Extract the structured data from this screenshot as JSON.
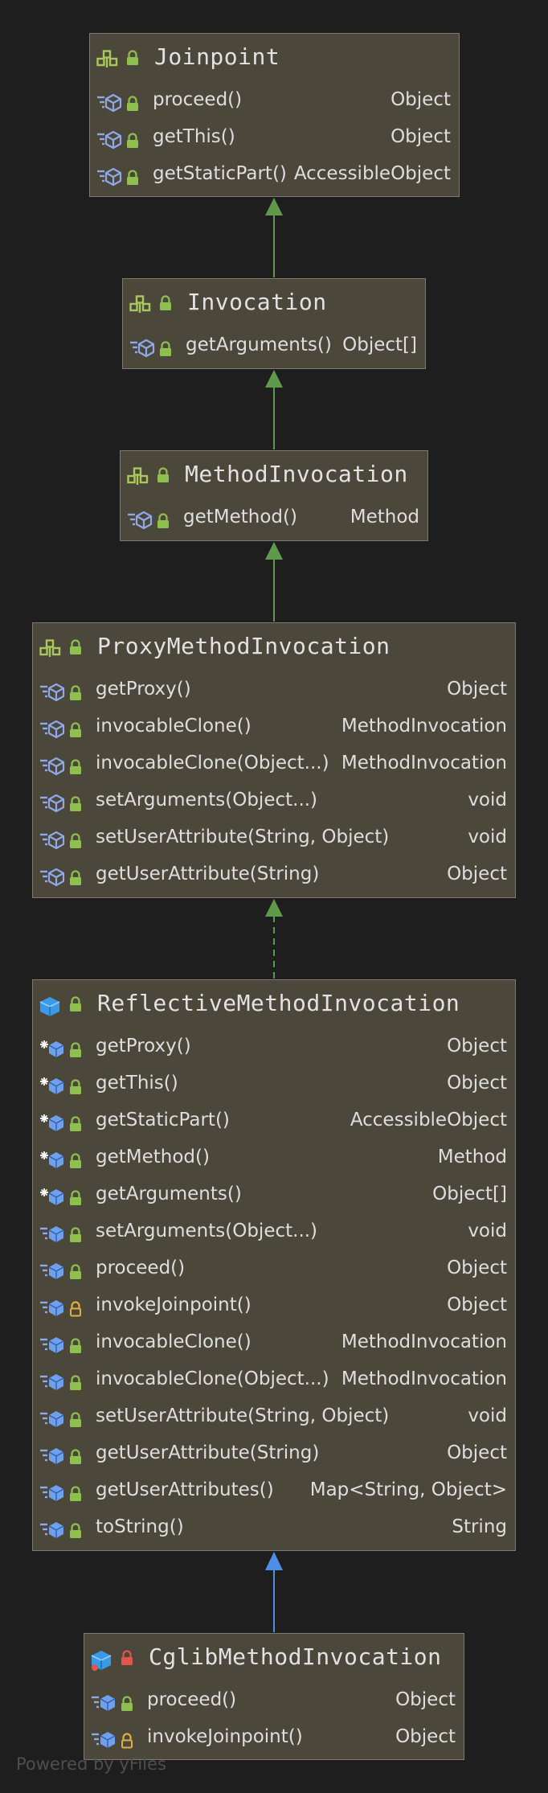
{
  "nodes": {
    "joinpoint": {
      "title": "Joinpoint",
      "kind": "interface",
      "members": [
        {
          "name": "proceed()",
          "type": "Object",
          "icon": "abstract-method-icon",
          "lock": "public"
        },
        {
          "name": "getThis()",
          "type": "Object",
          "icon": "abstract-method-icon",
          "lock": "public"
        },
        {
          "name": "getStaticPart()",
          "type": "AccessibleObject",
          "icon": "abstract-method-icon",
          "lock": "public"
        }
      ]
    },
    "invocation": {
      "title": "Invocation",
      "kind": "interface",
      "members": [
        {
          "name": "getArguments()",
          "type": "Object[]",
          "icon": "abstract-method-icon",
          "lock": "public"
        }
      ]
    },
    "method_invocation": {
      "title": "MethodInvocation",
      "kind": "interface",
      "members": [
        {
          "name": "getMethod()",
          "type": "Method",
          "icon": "abstract-method-icon",
          "lock": "public"
        }
      ]
    },
    "proxy_method_invocation": {
      "title": "ProxyMethodInvocation",
      "kind": "interface",
      "members": [
        {
          "name": "getProxy()",
          "type": "Object",
          "icon": "abstract-method-icon",
          "lock": "public"
        },
        {
          "name": "invocableClone()",
          "type": "MethodInvocation",
          "icon": "abstract-method-icon",
          "lock": "public"
        },
        {
          "name": "invocableClone(Object...)",
          "type": "MethodInvocation",
          "icon": "abstract-method-icon",
          "lock": "public"
        },
        {
          "name": "setArguments(Object...)",
          "type": "void",
          "icon": "abstract-method-icon",
          "lock": "public"
        },
        {
          "name": "setUserAttribute(String, Object)",
          "type": "void",
          "icon": "abstract-method-icon",
          "lock": "public"
        },
        {
          "name": "getUserAttribute(String)",
          "type": "Object",
          "icon": "abstract-method-icon",
          "lock": "public"
        }
      ]
    },
    "reflective_method_invocation": {
      "title": "ReflectiveMethodInvocation",
      "kind": "class",
      "members": [
        {
          "name": "getProxy()",
          "type": "Object",
          "icon": "final-method-icon",
          "lock": "public"
        },
        {
          "name": "getThis()",
          "type": "Object",
          "icon": "final-method-icon",
          "lock": "public"
        },
        {
          "name": "getStaticPart()",
          "type": "AccessibleObject",
          "icon": "final-method-icon",
          "lock": "public"
        },
        {
          "name": "getMethod()",
          "type": "Method",
          "icon": "final-method-icon",
          "lock": "public"
        },
        {
          "name": "getArguments()",
          "type": "Object[]",
          "icon": "final-method-icon",
          "lock": "public"
        },
        {
          "name": "setArguments(Object...)",
          "type": "void",
          "icon": "method-icon",
          "lock": "public"
        },
        {
          "name": "proceed()",
          "type": "Object",
          "icon": "method-icon",
          "lock": "public"
        },
        {
          "name": "invokeJoinpoint()",
          "type": "Object",
          "icon": "method-icon",
          "lock": "protected"
        },
        {
          "name": "invocableClone()",
          "type": "MethodInvocation",
          "icon": "method-icon",
          "lock": "public"
        },
        {
          "name": "invocableClone(Object...)",
          "type": "MethodInvocation",
          "icon": "method-icon",
          "lock": "public"
        },
        {
          "name": "setUserAttribute(String, Object)",
          "type": "void",
          "icon": "method-icon",
          "lock": "public"
        },
        {
          "name": "getUserAttribute(String)",
          "type": "Object",
          "icon": "method-icon",
          "lock": "public"
        },
        {
          "name": "getUserAttributes()",
          "type": "Map<String, Object>",
          "icon": "method-icon",
          "lock": "public"
        },
        {
          "name": "toString()",
          "type": "String",
          "icon": "method-icon",
          "lock": "public"
        }
      ]
    },
    "cglib_method_invocation": {
      "title": "CglibMethodInvocation",
      "kind": "class",
      "class_lock": "private",
      "members": [
        {
          "name": "proceed()",
          "type": "Object",
          "icon": "method-icon",
          "lock": "public"
        },
        {
          "name": "invokeJoinpoint()",
          "type": "Object",
          "icon": "method-icon",
          "lock": "protected"
        }
      ]
    }
  },
  "edges": [
    {
      "from": "Invocation",
      "to": "Joinpoint",
      "kind": "extends",
      "style": "solid"
    },
    {
      "from": "MethodInvocation",
      "to": "Invocation",
      "kind": "extends",
      "style": "solid"
    },
    {
      "from": "ProxyMethodInvocation",
      "to": "MethodInvocation",
      "kind": "extends",
      "style": "solid"
    },
    {
      "from": "ReflectiveMethodInvocation",
      "to": "ProxyMethodInvocation",
      "kind": "implements",
      "style": "dashed"
    },
    {
      "from": "CglibMethodInvocation",
      "to": "ReflectiveMethodInvocation",
      "kind": "extends",
      "style": "solid"
    }
  ],
  "colors": {
    "background": "#1e1e1e",
    "node_fill": "#4b473b",
    "node_border": "#7c7a73",
    "interface_edge": "#5f9a4a",
    "class_edge": "#4d8fe8",
    "public_lock": "#8fbf4f",
    "protected_lock": "#e0b03f",
    "private_lock": "#e0554f"
  },
  "footer": "Powered by yFiles"
}
